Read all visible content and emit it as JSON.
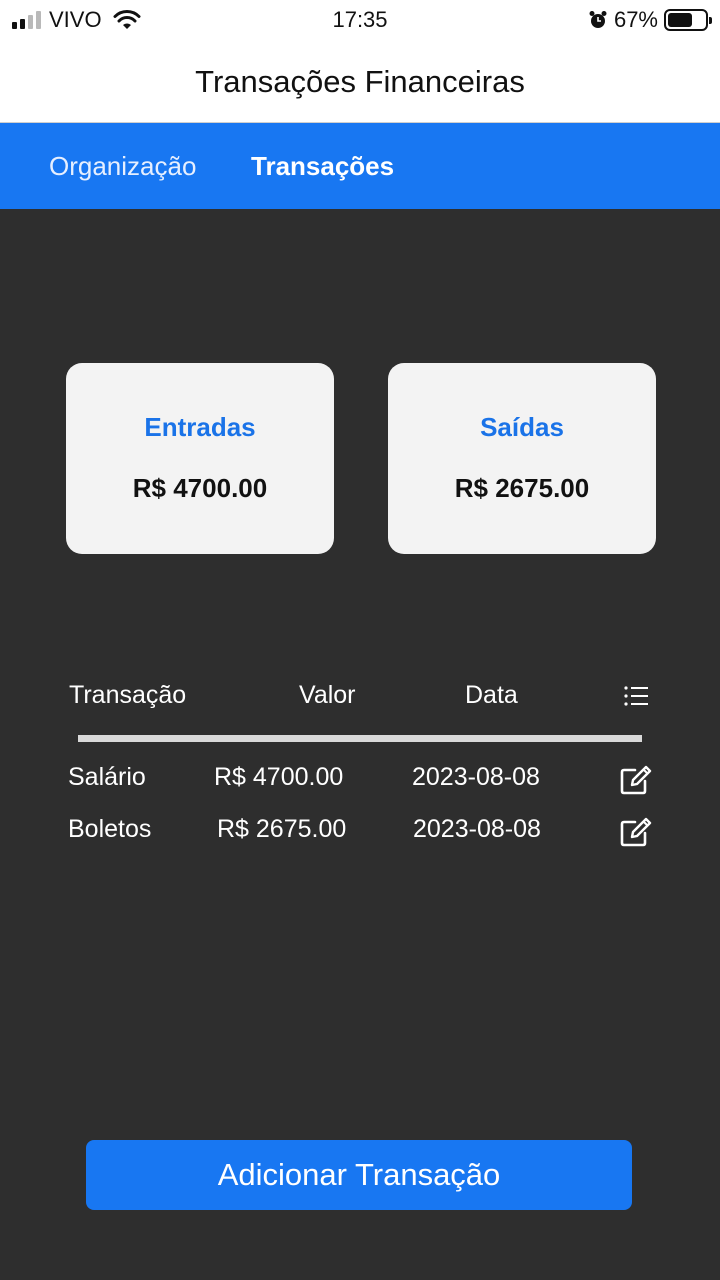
{
  "status_bar": {
    "carrier": "VIVO",
    "time": "17:35",
    "battery_percent": "67%",
    "battery_level": 0.67,
    "signal_icon": "signal-bars-icon",
    "wifi_icon": "wifi-icon",
    "alarm_icon": "alarm-clock-icon"
  },
  "header": {
    "title": "Transações Financeiras"
  },
  "tabs": [
    {
      "label": "Organização",
      "active": false
    },
    {
      "label": "Transações",
      "active": true
    }
  ],
  "summary": {
    "income": {
      "label": "Entradas",
      "value": "R$ 4700.00"
    },
    "expenses": {
      "label": "Saídas",
      "value": "R$ 2675.00"
    }
  },
  "table": {
    "columns": [
      "Transação",
      "Valor",
      "Data"
    ],
    "menu_icon": "list-icon",
    "edit_icon": "edit-icon",
    "rows": [
      {
        "name": "Salário",
        "value": "R$ 4700.00",
        "date": "2023-08-08"
      },
      {
        "name": "Boletos",
        "value": "R$ 2675.00",
        "date": "2023-08-08"
      }
    ]
  },
  "actions": {
    "add_label": "Adicionar Transação"
  },
  "colors": {
    "accent": "#1877f2",
    "card_label": "#1a73e8",
    "background": "#2e2e2e",
    "card_bg": "#f3f3f3"
  }
}
